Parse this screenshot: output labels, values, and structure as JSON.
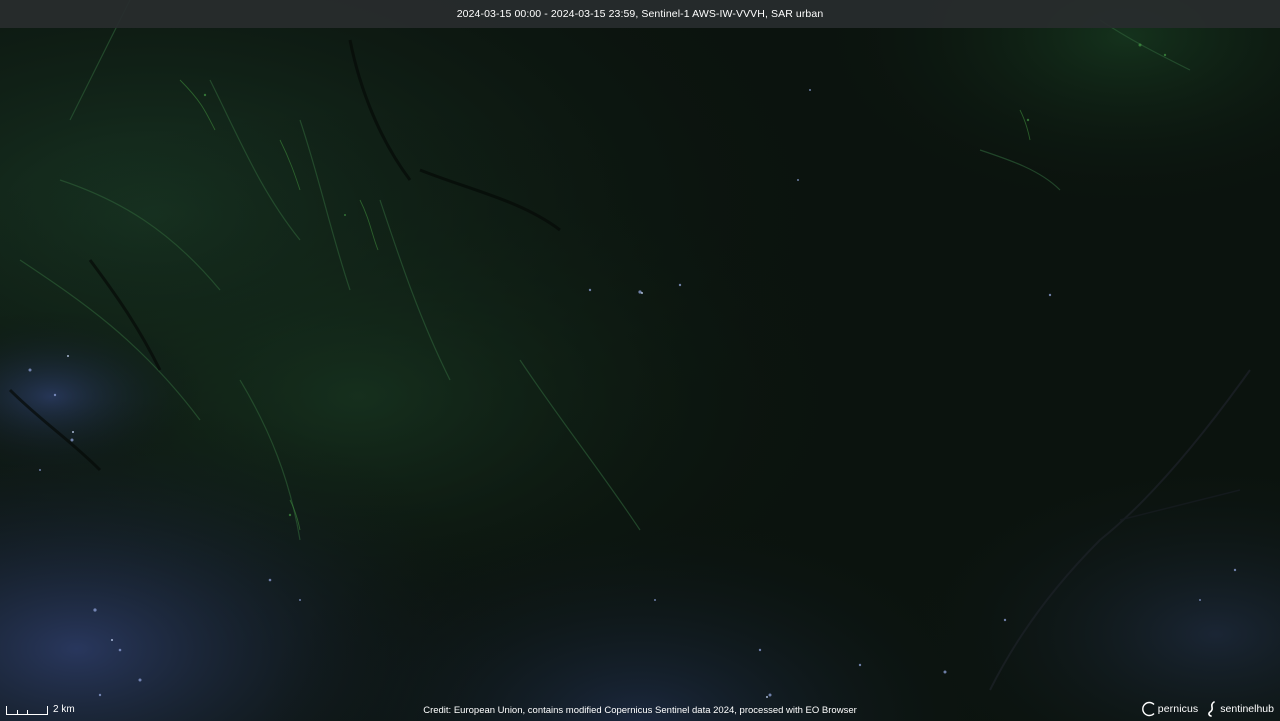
{
  "header": {
    "title": "2024-03-15 00:00 - 2024-03-15 23:59, Sentinel-1 AWS-IW-VVVH, SAR urban"
  },
  "scale": {
    "label": "2 km"
  },
  "footer": {
    "credit": "Credit: European Union, contains modified Copernicus Sentinel data 2024, processed with EO Browser"
  },
  "logos": {
    "copernicus_text": "pernicus",
    "copernicus_prefix": "C",
    "sentinelhub_text": "sentinelhub"
  },
  "colors": {
    "background": "#0b130e",
    "terrain_green": "#1f4a2a",
    "urban_blue": "#3a4c8a",
    "banner": "#282c2e",
    "text": "#ffffff"
  }
}
